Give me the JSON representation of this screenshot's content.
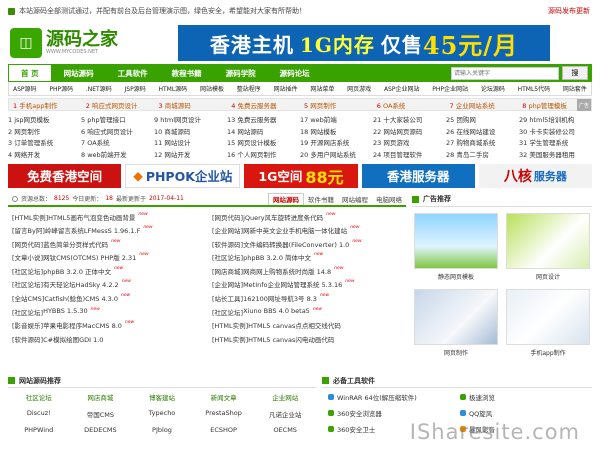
{
  "topbar": {
    "notice": "本站源码全部测试通过，并配有前台及后台管理演示图，绿色安全，希望能对大家有所帮助！",
    "release_link": "源码发布更新"
  },
  "header": {
    "logo_text": "源码之家",
    "logo_sub": "WWW.MYCODES.NET",
    "banner": {
      "a": "香港主机",
      "b": "1G内存",
      "c": "仅售",
      "d": "45元/月"
    }
  },
  "nav": {
    "items": [
      "首 页",
      "网站源码",
      "工具软件",
      "教程书籍",
      "源码学院",
      "源码论坛"
    ],
    "search_placeholder": "请输入关键字",
    "search_button": "搜"
  },
  "subnav": [
    "ASP源码",
    "PHP源码",
    ".NET源码",
    "JSP源码",
    "HTML源码",
    "网站模板",
    "整站程序",
    "网站插件",
    "网站菜单",
    "网页游戏",
    "ASP企业网站",
    "PHP企业网站",
    "论坛源码",
    "HTML5代码",
    "网站套件"
  ],
  "adstrip": [
    {
      "n": "1",
      "t": "手机app制作"
    },
    {
      "n": "2",
      "t": "响应式网页设计"
    },
    {
      "n": "3",
      "t": "商城源码"
    },
    {
      "n": "4",
      "t": "免费云服务器"
    },
    {
      "n": "5",
      "t": "网页制作"
    },
    {
      "n": "6",
      "t": "OA系统"
    },
    {
      "n": "7",
      "t": "企业网站系统"
    },
    {
      "n": "8",
      "t": "php管理模板"
    }
  ],
  "adstrip_tag": "广告",
  "linkgrid": [
    "1 jsp网页模板",
    "5 php管理接口",
    "9 html网页设计",
    "13 免费云服务器",
    "17 web前端",
    "21 十大家装公司",
    "25 团购网",
    "29 html5培训机构",
    "2 网页制作",
    "6 响应式网页设计",
    "10 商城源码",
    "14 网站源码",
    "18 网站模板",
    "22 网站网页源码",
    "26 在线网站建设",
    "30 卡卡实装修公司",
    "3 订单管理系统",
    "7 OA系统",
    "11 网站设计",
    "15 网页设计模板",
    "19 开源网店系统",
    "23 网页游戏",
    "27 购物商城系统",
    "31 学生管理系统",
    "4 网络开发",
    "8 web前端开发",
    "12 网站开发",
    "16 个人网页制作",
    "20 多用户网站系统",
    "24 项目管理软件",
    "28 青岛二手房",
    "32 美国服务器租用"
  ],
  "bigads": {
    "a1": "免费香港空间",
    "a2": "PHPOK企业站",
    "a3": "1G空间",
    "a3n": "88元",
    "a4": "香港服务器",
    "a5a": "八核",
    "a5b": "服务器"
  },
  "stats": {
    "label": "资源总数：",
    "total": "8125",
    "today_label": "今日更新：",
    "today": "18",
    "date_label": "最新更新于",
    "date": "2017-04-11"
  },
  "tabs": [
    "网站源码",
    "软件书籍",
    "网站编程",
    "电脑网络"
  ],
  "news_left": [
    {
      "c": "[HTML实例]",
      "t": "HTML5画布气泡变色动画背景",
      "n": "new"
    },
    {
      "c": "[留言By阿]",
      "t": "岭峰留言系统LFMessS 1.96.1.F",
      "n": "new"
    },
    {
      "c": "[网页代码]",
      "t": "蓝色简单分页样式代码",
      "n": "new"
    },
    {
      "c": "[文章小说]",
      "t": "网钛CMS(OTCMS) PHP版 2.31",
      "n": "new"
    },
    {
      "c": "[社区论坛]",
      "t": "phpBB 3.2.0 正体中文",
      "n": "new"
    },
    {
      "c": "[社区论坛]",
      "t": "有天轻论坛HadSky 4.2.2",
      "n": "new"
    },
    {
      "c": "[全站CMS]",
      "t": "Catfish(鲶鱼)CMS 4.3.0",
      "n": "new"
    },
    {
      "c": "[社区论坛]",
      "t": "HYBBS 1.5.30",
      "n": "new"
    },
    {
      "c": "[影音娱乐]",
      "t": "苹果电影程序MacCMS 8.0",
      "n": "new"
    },
    {
      "c": "[软件源码]",
      "t": "C#模拟绘图GDI 1.0",
      "n": ""
    }
  ],
  "news_right": [
    {
      "c": "[网页代码]",
      "t": "jQuery风车旋转进度条代码",
      "n": "new"
    },
    {
      "c": "[企业网站]",
      "t": "网新中英文企业手机电脑一体化建站",
      "n": "new"
    },
    {
      "c": "[软件源码]",
      "t": "文件编码转换器(FileConverter) 1.0",
      "n": "new"
    },
    {
      "c": "[社区论坛]",
      "t": "phpBB 3.2.0 简体中文",
      "n": "new"
    },
    {
      "c": "[网店商城]",
      "t": "网商网上购物系统时尚版 14.8",
      "n": "new"
    },
    {
      "c": "[企业网站]",
      "t": "MetInfo企业网站管理系统 5.3.16",
      "n": "new"
    },
    {
      "c": "[站长工具]",
      "t": "162100网址导航3号 8.3",
      "n": "new"
    },
    {
      "c": "[社区论坛]",
      "t": "Xiuno BBS 4.0 beta5",
      "n": "new"
    },
    {
      "c": "[HTML实例]",
      "t": "HTML5 canvas点点相交线代码",
      "n": ""
    },
    {
      "c": "[HTML实例]",
      "t": "HTML5 canvas闪电动画代码",
      "n": ""
    }
  ],
  "sidebar": {
    "title": "广告推荐",
    "thumbs": [
      "静态网页模板",
      "网页设计",
      "网页制作",
      "手机app制作"
    ]
  },
  "bottom": {
    "left_title": "网站源码推荐",
    "cats": [
      "社区论坛",
      "网店商城",
      "博客建站",
      "新闻文章",
      "企业网站"
    ],
    "row1": [
      "Discuz!",
      "帝国CMS",
      "Typecho",
      "PrestaShop",
      "凡诺企业站"
    ],
    "row2": [
      "PHPWind",
      "DEDECMS",
      "PJblog",
      "ECSHOP",
      "OECMS"
    ],
    "right_title": "必备工具软件",
    "tools": [
      "WinRAR 64位(解压缩软件)",
      "极速浏览",
      "360安全浏览器",
      "QQ旋风",
      "360安全卫士",
      "暴风影音"
    ]
  },
  "watermark": "ISharesite.com"
}
